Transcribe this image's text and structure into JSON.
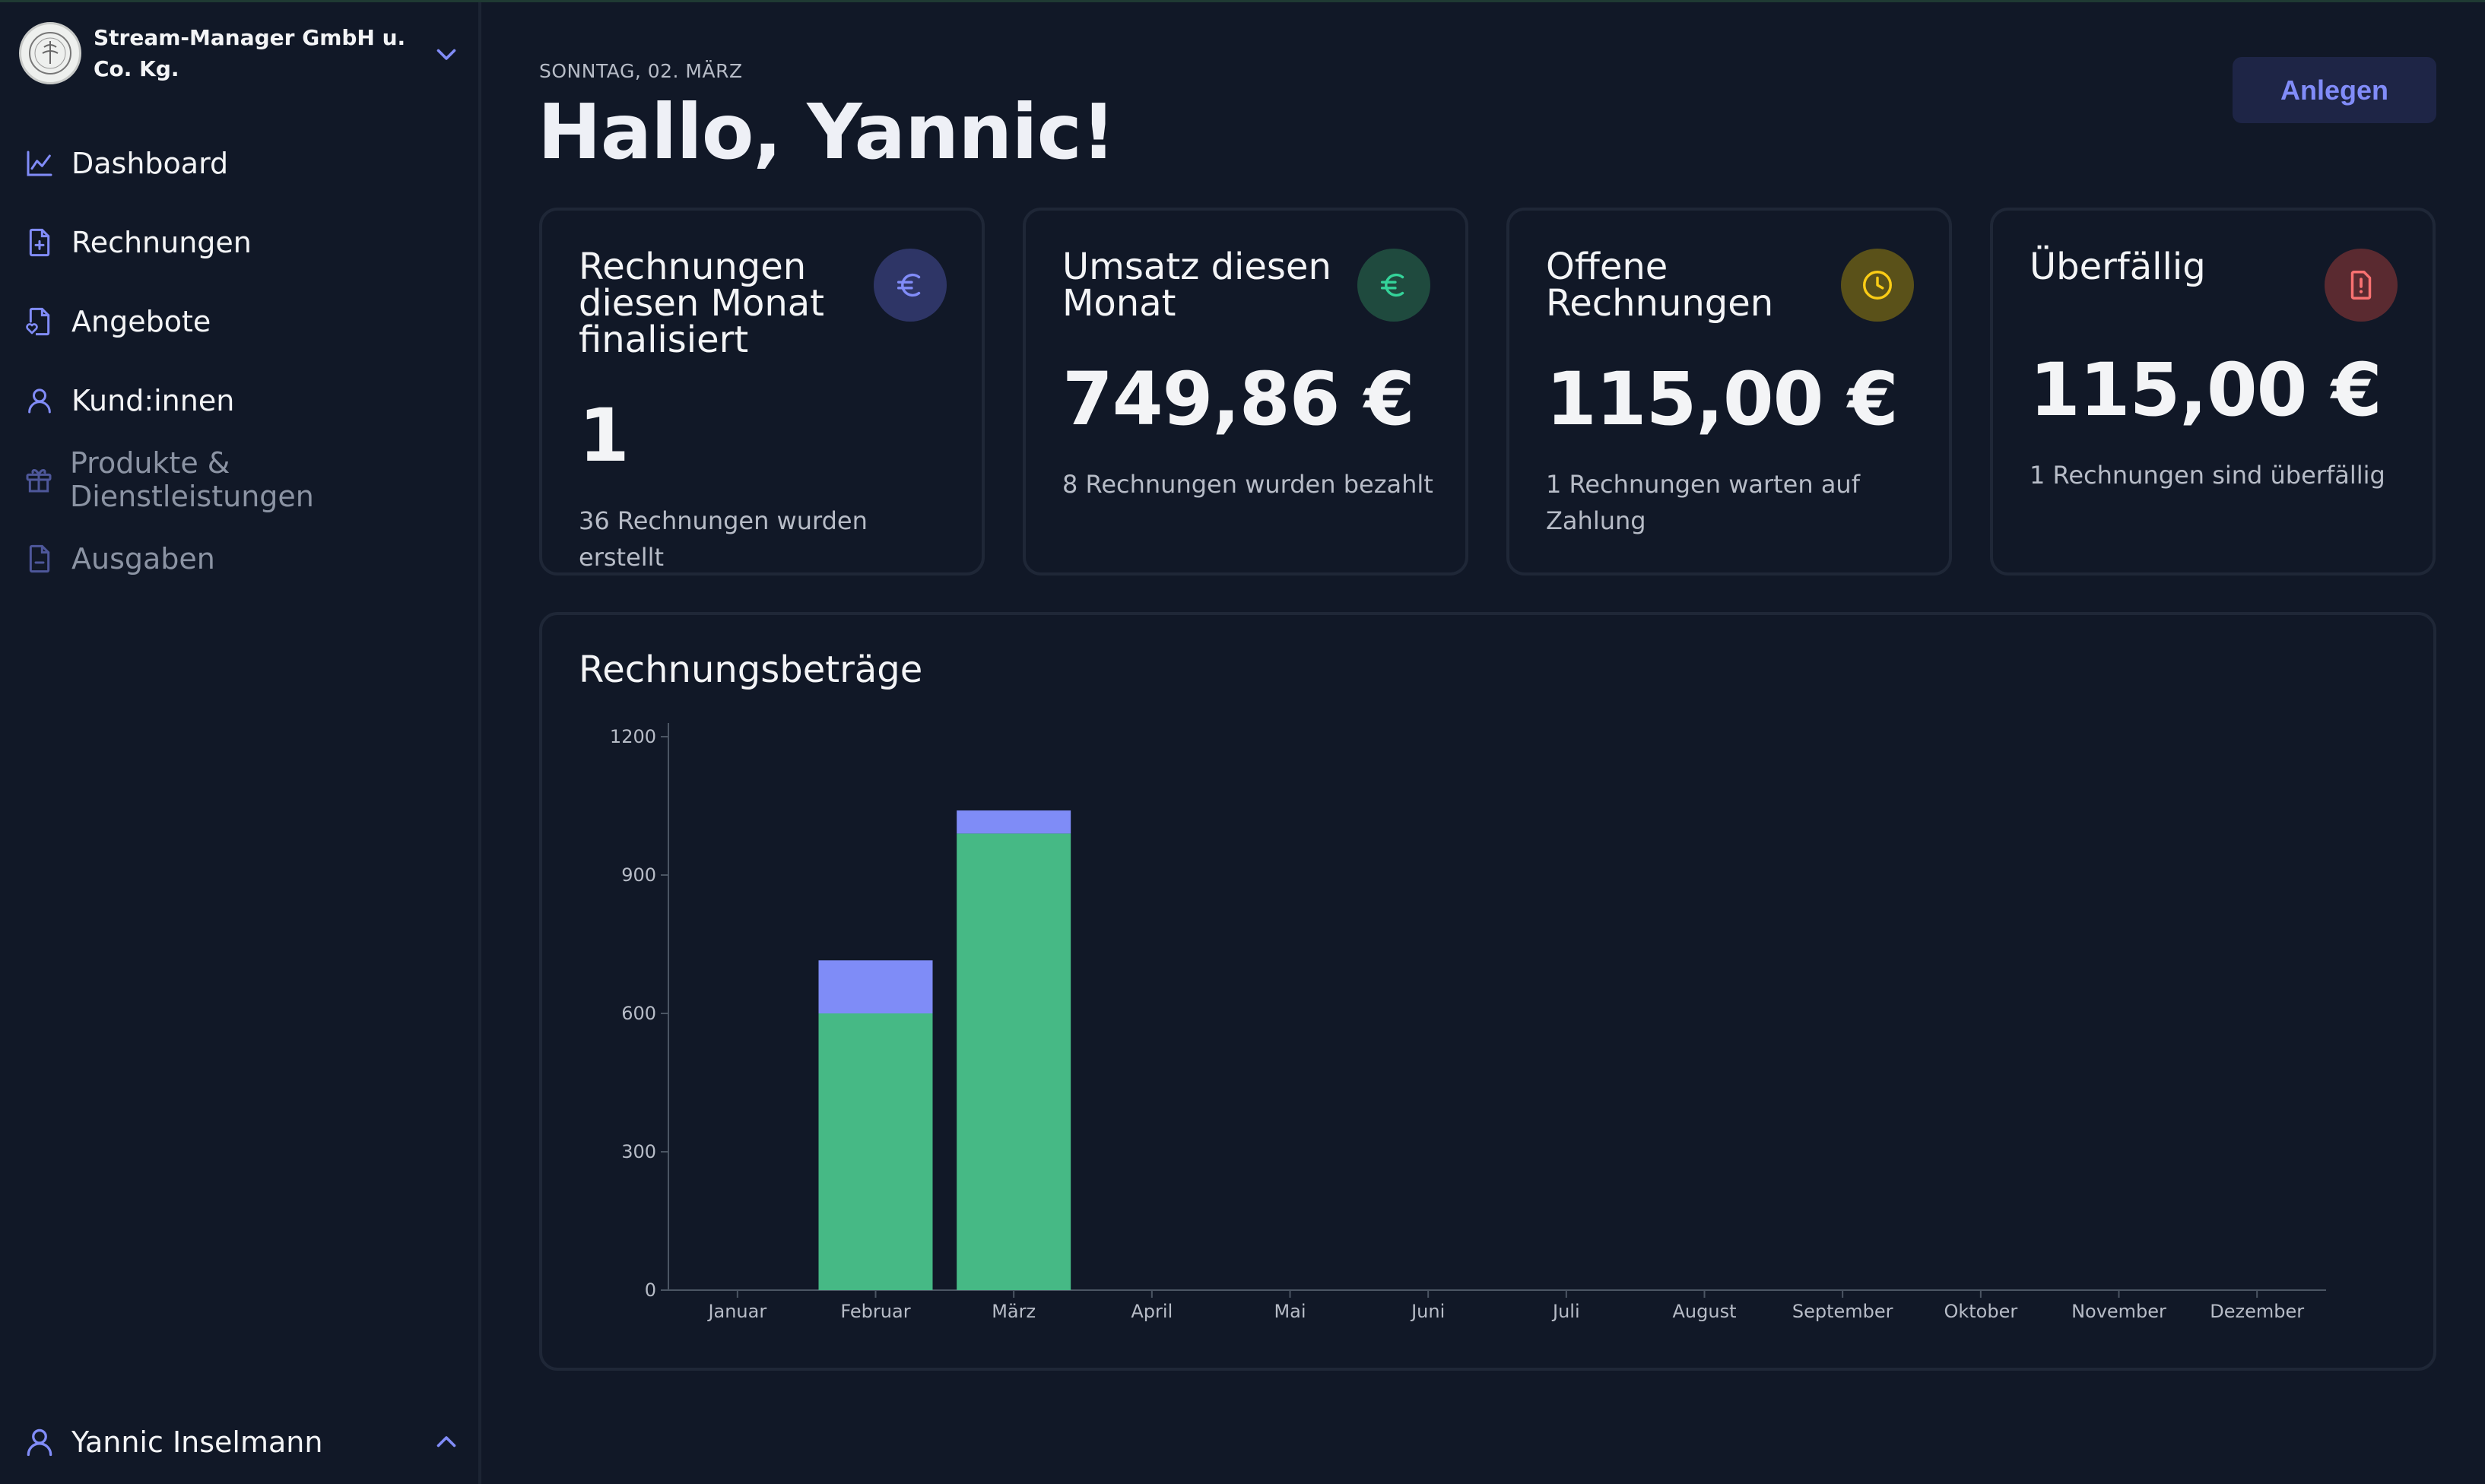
{
  "org": {
    "name": "Stream-Manager GmbH u. Co. Kg."
  },
  "nav": {
    "items": [
      {
        "label": "Dashboard",
        "icon": "chart-icon"
      },
      {
        "label": "Rechnungen",
        "icon": "file-plus-icon"
      },
      {
        "label": "Angebote",
        "icon": "file-heart-icon"
      },
      {
        "label": "Kund:innen",
        "icon": "user-icon"
      },
      {
        "label": "Produkte & Dienstleistungen",
        "icon": "gift-icon"
      },
      {
        "label": "Ausgaben",
        "icon": "file-minus-icon"
      }
    ]
  },
  "user": {
    "name": "Yannic Inselmann"
  },
  "header": {
    "date": "SONNTAG, 02. MÄRZ",
    "greeting": "Hallo, Yannic!",
    "create_label": "Anlegen"
  },
  "cards": [
    {
      "title": "Rechnungen diesen Monat finalisiert",
      "value": "1",
      "sub": "36 Rechnungen wurden erstellt",
      "icon": "euro-icon",
      "color": "#818cf8"
    },
    {
      "title": "Umsatz diesen Monat",
      "value": "749,86 €",
      "sub": "8 Rechnungen wurden bezahlt",
      "icon": "euro-icon",
      "color": "#34d399"
    },
    {
      "title": "Offene Rechnungen",
      "value": "115,00 €",
      "sub": "1 Rechnungen warten auf Zahlung",
      "icon": "clock-icon",
      "color": "#facc15"
    },
    {
      "title": "Überfällig",
      "value": "115,00 €",
      "sub": "1 Rechnungen sind überfällig",
      "icon": "alert-icon",
      "color": "#f87171"
    }
  ],
  "colors": {
    "paid": "#46b985",
    "open": "#7f8cf7",
    "accent": "#818cf8"
  },
  "chart_data": {
    "type": "bar",
    "title": "Rechnungsbeträge",
    "stacked": true,
    "categories": [
      "Januar",
      "Februar",
      "März",
      "April",
      "Mai",
      "Juni",
      "Juli",
      "August",
      "September",
      "Oktober",
      "November",
      "Dezember"
    ],
    "series": [
      {
        "values": [
          0,
          600,
          990,
          0,
          0,
          0,
          0,
          0,
          0,
          0,
          0,
          0
        ],
        "color": "#46b985"
      },
      {
        "values": [
          0,
          115,
          50,
          0,
          0,
          0,
          0,
          0,
          0,
          0,
          0,
          0
        ],
        "color": "#7f8cf7"
      }
    ],
    "yticks": [
      0,
      300,
      600,
      900,
      1200
    ],
    "ylim": [
      0,
      1200
    ],
    "legend": "none",
    "grid": false
  }
}
